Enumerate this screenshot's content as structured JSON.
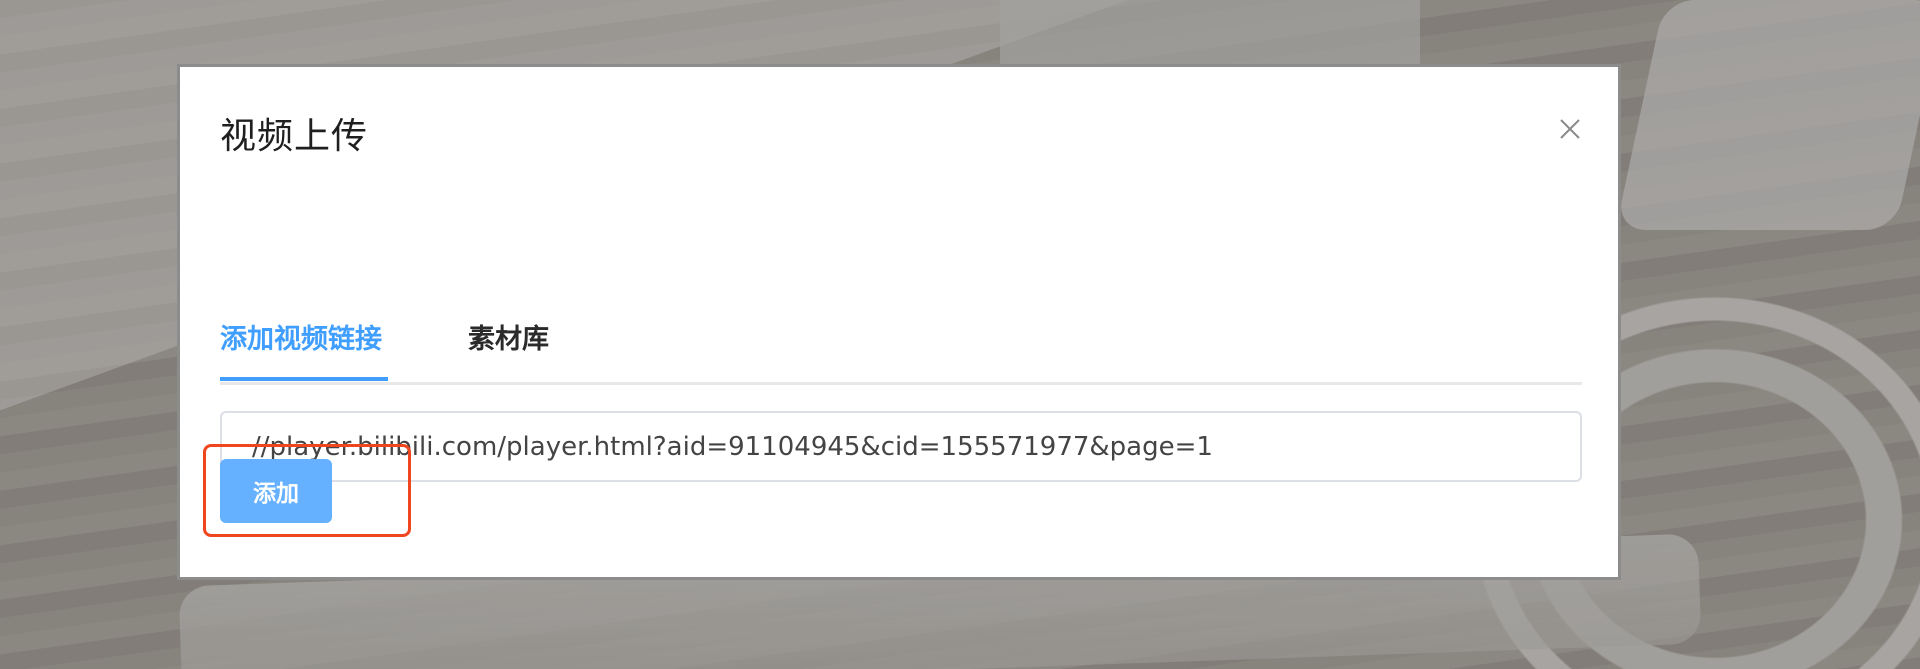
{
  "modal": {
    "title": "视频上传",
    "close_icon": "close-icon"
  },
  "tabs": [
    {
      "label": "添加视频链接",
      "active": true
    },
    {
      "label": "素材库",
      "active": false
    }
  ],
  "url_input": {
    "value": "//player.bilibili.com/player.html?aid=91104945&cid=155571977&page=1"
  },
  "add_button": {
    "label": "添加"
  },
  "colors": {
    "accent": "#409eff",
    "button": "#66b1ff",
    "highlight": "#f0461f"
  }
}
